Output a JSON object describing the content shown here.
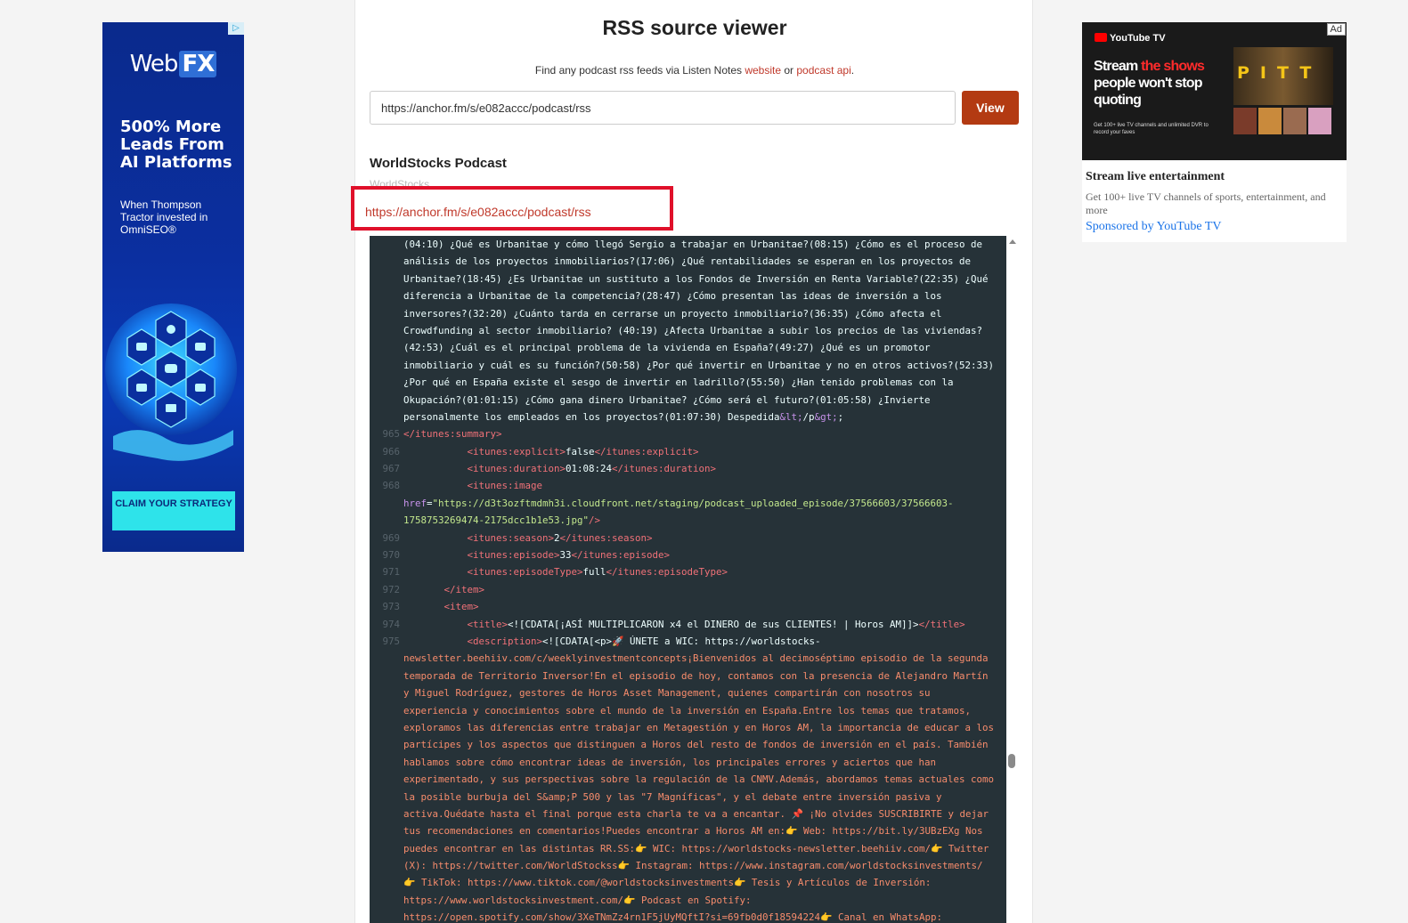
{
  "left_ad": {
    "adchoices": "▷",
    "logo_web": "Web",
    "logo_fx": "FX",
    "headline": "500% More Leads From AI Platforms",
    "subtext": "When Thompson Tractor invested in OmniSEO®",
    "cta": "CLAIM YOUR STRATEGY"
  },
  "header": {
    "title": "RSS source viewer",
    "subtitle_prefix": "Find any podcast rss feeds via Listen Notes ",
    "subtitle_link1": "website",
    "subtitle_mid": " or ",
    "subtitle_link2": "podcast api",
    "subtitle_suffix": "."
  },
  "search": {
    "value": "https://anchor.fm/s/e082accc/podcast/rss",
    "button": "View"
  },
  "podcast": {
    "title": "WorldStocks Podcast",
    "author": "WorldStocks",
    "feed_url": "https://anchor.fm/s/e082accc/podcast/rss"
  },
  "code_lines": [
    {
      "n": "",
      "parts": [
        {
          "c": "val",
          "t": "(04:10) ¿Qué es Urbanitae y cómo llegó Sergio a trabajar en Urbanitae?(08:15) ¿Cómo es el proceso de"
        }
      ]
    },
    {
      "n": "",
      "parts": [
        {
          "c": "val",
          "t": "análisis de los proyectos inmobiliarios?(17:06) ¿Qué rentabilidades se esperan en los proyectos de"
        }
      ]
    },
    {
      "n": "",
      "parts": [
        {
          "c": "val",
          "t": "Urbanitae?(18:45) ¿Es Urbanitae un sustituto a los Fondos de Inversión en Renta Variable?(22:35) ¿Qué"
        }
      ]
    },
    {
      "n": "",
      "parts": [
        {
          "c": "val",
          "t": "diferencia a Urbanitae de la competencia?(28:47) ¿Cómo presentan las ideas de inversión a los"
        }
      ]
    },
    {
      "n": "",
      "parts": [
        {
          "c": "val",
          "t": "inversores?(32:20) ¿Cuánto tarda en cerrarse un proyecto inmobiliario?(36:35) ¿Cómo afecta el"
        }
      ]
    },
    {
      "n": "",
      "parts": [
        {
          "c": "val",
          "t": "Crowdfunding al sector inmobiliario? (40:19) ¿Afecta Urbanitae a subir los precios de las viviendas?"
        }
      ]
    },
    {
      "n": "",
      "parts": [
        {
          "c": "val",
          "t": "(42:53) ¿Cuál es el principal problema de la vivienda en España?(49:27) ¿Qué es un promotor"
        }
      ]
    },
    {
      "n": "",
      "parts": [
        {
          "c": "val",
          "t": "inmobiliario y cuál es su función?(50:58) ¿Por qué invertir en Urbanitae y no en otros activos?(52:33)"
        }
      ]
    },
    {
      "n": "",
      "parts": [
        {
          "c": "val",
          "t": "¿Por qué en España existe el sesgo de invertir en ladrillo?(55:50) ¿Han tenido problemas con la"
        }
      ]
    },
    {
      "n": "",
      "parts": [
        {
          "c": "val",
          "t": "Okupación?(01:01:15) ¿Cómo gana dinero Urbanitae? ¿Cómo será el futuro?(01:05:58) ¿Invierte"
        }
      ]
    },
    {
      "n": "",
      "parts": [
        {
          "c": "val",
          "t": "personalmente los empleados en los proyectos?(01:07:30) Despedida"
        },
        {
          "c": "attr",
          "t": "&lt;"
        },
        {
          "c": "val",
          "t": "/p"
        },
        {
          "c": "attr",
          "t": "&gt;"
        },
        {
          "c": "val",
          "t": ";"
        }
      ]
    },
    {
      "n": "965",
      "parts": [
        {
          "c": "tag",
          "t": "</itunes:summary>"
        }
      ]
    },
    {
      "n": "966",
      "parts": [
        {
          "c": "val",
          "t": "           "
        },
        {
          "c": "tag",
          "t": "<itunes:explicit>"
        },
        {
          "c": "val",
          "t": "false"
        },
        {
          "c": "tag",
          "t": "</itunes:explicit>"
        }
      ]
    },
    {
      "n": "967",
      "parts": [
        {
          "c": "val",
          "t": "           "
        },
        {
          "c": "tag",
          "t": "<itunes:duration>"
        },
        {
          "c": "val",
          "t": "01:08:24"
        },
        {
          "c": "tag",
          "t": "</itunes:duration>"
        }
      ]
    },
    {
      "n": "968",
      "parts": [
        {
          "c": "val",
          "t": "           "
        },
        {
          "c": "tag",
          "t": "<itunes:image"
        }
      ]
    },
    {
      "n": "",
      "parts": [
        {
          "c": "attr",
          "t": "href"
        },
        {
          "c": "val",
          "t": "="
        },
        {
          "c": "str",
          "t": "\"https://d3t3ozftmdmh3i.cloudfront.net/staging/podcast_uploaded_episode/37566603/37566603-"
        }
      ]
    },
    {
      "n": "",
      "parts": [
        {
          "c": "str",
          "t": "1758753269474-2175dcc1b1e53.jpg\""
        },
        {
          "c": "tag",
          "t": "/>"
        }
      ]
    },
    {
      "n": "969",
      "parts": [
        {
          "c": "val",
          "t": "           "
        },
        {
          "c": "tag",
          "t": "<itunes:season>"
        },
        {
          "c": "val",
          "t": "2"
        },
        {
          "c": "tag",
          "t": "</itunes:season>"
        }
      ]
    },
    {
      "n": "970",
      "parts": [
        {
          "c": "val",
          "t": "           "
        },
        {
          "c": "tag",
          "t": "<itunes:episode>"
        },
        {
          "c": "val",
          "t": "33"
        },
        {
          "c": "tag",
          "t": "</itunes:episode>"
        }
      ]
    },
    {
      "n": "971",
      "parts": [
        {
          "c": "val",
          "t": "           "
        },
        {
          "c": "tag",
          "t": "<itunes:episodeType>"
        },
        {
          "c": "val",
          "t": "full"
        },
        {
          "c": "tag",
          "t": "</itunes:episodeType>"
        }
      ]
    },
    {
      "n": "972",
      "parts": [
        {
          "c": "val",
          "t": "       "
        },
        {
          "c": "tag",
          "t": "</item>"
        }
      ]
    },
    {
      "n": "973",
      "parts": [
        {
          "c": "val",
          "t": "       "
        },
        {
          "c": "tag",
          "t": "<item>"
        }
      ]
    },
    {
      "n": "974",
      "parts": [
        {
          "c": "val",
          "t": "           "
        },
        {
          "c": "tag",
          "t": "<title>"
        },
        {
          "c": "val",
          "t": "<![CDATA[¡ASÍ MULTIPLICARON x4 el DINERO de sus CLIENTES! | Horos AM]]>"
        },
        {
          "c": "tag",
          "t": "</title>"
        }
      ]
    },
    {
      "n": "975",
      "parts": [
        {
          "c": "val",
          "t": "           "
        },
        {
          "c": "tag",
          "t": "<description>"
        },
        {
          "c": "val",
          "t": "<![CDATA[<p>🚀 ÚNETE a WIC: https://worldstocks-"
        }
      ]
    },
    {
      "n": "",
      "parts": [
        {
          "c": "desc",
          "t": "newsletter.beehiiv.com/c/weeklyinvestmentconcepts¡Bienvenidos al decimoséptimo episodio de la segunda"
        }
      ]
    },
    {
      "n": "",
      "parts": [
        {
          "c": "desc",
          "t": "temporada de Territorio Inversor!En el episodio de hoy, contamos con la presencia de Alejandro Martín"
        }
      ]
    },
    {
      "n": "",
      "parts": [
        {
          "c": "desc",
          "t": "y Miguel Rodríguez, gestores de Horos Asset Management, quienes compartirán con nosotros su"
        }
      ]
    },
    {
      "n": "",
      "parts": [
        {
          "c": "desc",
          "t": "experiencia y conocimientos sobre el mundo de la inversión en España.Entre los temas que tratamos,"
        }
      ]
    },
    {
      "n": "",
      "parts": [
        {
          "c": "desc",
          "t": "exploramos las diferencias entre trabajar en Metagestión y en Horos AM, la importancia de educar a los"
        }
      ]
    },
    {
      "n": "",
      "parts": [
        {
          "c": "desc",
          "t": "partícipes y los aspectos que distinguen a Horos del resto de fondos de inversión en el país. También"
        }
      ]
    },
    {
      "n": "",
      "parts": [
        {
          "c": "desc",
          "t": "hablamos sobre cómo encontrar ideas de inversión, los principales errores y aciertos que han"
        }
      ]
    },
    {
      "n": "",
      "parts": [
        {
          "c": "desc",
          "t": "experimentado, y sus perspectivas sobre la regulación de la CNMV.Además, abordamos temas actuales como"
        }
      ]
    },
    {
      "n": "",
      "parts": [
        {
          "c": "desc",
          "t": "la posible burbuja del S&amp;P 500 y las \"7 Magníficas\", y el debate entre inversión pasiva y"
        }
      ]
    },
    {
      "n": "",
      "parts": [
        {
          "c": "desc",
          "t": "activa.Quédate hasta el final porque esta charla te va a encantar. 📌 ¡No olvides SUSCRIBIRTE y dejar"
        }
      ]
    },
    {
      "n": "",
      "parts": [
        {
          "c": "desc",
          "t": "tus recomendaciones en comentarios!Puedes encontrar a Horos AM en:👉 Web: https://bit.ly/3UBzEXg Nos"
        }
      ]
    },
    {
      "n": "",
      "parts": [
        {
          "c": "desc",
          "t": "puedes encontrar en las distintas RR.SS:👉 WIC: https://worldstocks-newsletter.beehiiv.com/👉 Twitter"
        }
      ]
    },
    {
      "n": "",
      "parts": [
        {
          "c": "desc",
          "t": "(X): https://twitter.com/WorldStockss👉 Instagram: https://www.instagram.com/worldstocksinvestments/"
        }
      ]
    },
    {
      "n": "",
      "parts": [
        {
          "c": "desc",
          "t": "👉 TikTok: https://www.tiktok.com/@worldstocksinvestments👉 Tesis y Artículos de Inversión:"
        }
      ]
    },
    {
      "n": "",
      "parts": [
        {
          "c": "desc",
          "t": "https://www.worldstocksinvestment.com/👉 Podcast en Spotify:"
        }
      ]
    },
    {
      "n": "",
      "parts": [
        {
          "c": "desc",
          "t": "https://open.spotify.com/show/3XeTNmZz4rn1F5jUyMQftI?si=69fb0d0f18594224👉 Canal en WhatsApp:"
        }
      ]
    }
  ],
  "right_ad": {
    "badge": "Ad",
    "brand": "YouTube TV",
    "headline_1": "Stream ",
    "headline_red": "the shows",
    "headline_2": " people won't stop quoting",
    "fine_print": "Get 100+ live TV channels and unlimited DVR to record your faves",
    "poster_text": "PITT",
    "title": "Stream live entertainment",
    "description": "Get 100+ live TV channels of sports, entertainment, and more",
    "sponsor": "Sponsored by YouTube TV"
  },
  "colors": {
    "accent": "#b33a12",
    "link": "#c0392b",
    "highlight_border": "#e0102a",
    "code_bg": "#263238"
  }
}
